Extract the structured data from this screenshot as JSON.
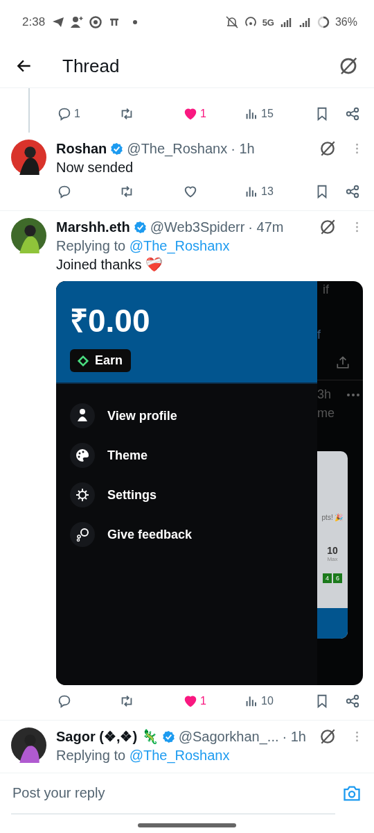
{
  "status_bar": {
    "time": "2:38",
    "network": "5G",
    "battery": "36%"
  },
  "header": {
    "title": "Thread"
  },
  "tweets": [
    {
      "kind": "actions_only",
      "actions": {
        "replies": "1",
        "liked": true,
        "likes": "1",
        "views": "15"
      }
    },
    {
      "kind": "post",
      "name": "Roshan",
      "verified": true,
      "handle": "@The_Roshanx",
      "separator": "·",
      "time": "1h",
      "text": "Now sended",
      "actions": {
        "liked": false,
        "views": "13"
      }
    },
    {
      "kind": "post",
      "name": "Marshh.eth",
      "verified": true,
      "handle": "@Web3Spiderr",
      "separator": "·",
      "time": "47m",
      "replying_label": "Replying to",
      "replying_to": "@The_Roshanx",
      "text": "Joined thanks ❤️‍🩹",
      "embed": {
        "balance": "₹0.00",
        "earn_label": "Earn",
        "menu": [
          {
            "kind": "profile",
            "label": "View profile"
          },
          {
            "kind": "theme",
            "label": "Theme"
          },
          {
            "kind": "settings",
            "label": "Settings"
          },
          {
            "kind": "feedback",
            "label": "Give feedback"
          }
        ],
        "behind": [
          "if",
          "f",
          "3h",
          "me",
          "pts! 🎉",
          "10",
          "Max",
          "4",
          "6"
        ]
      },
      "actions": {
        "liked": true,
        "likes": "1",
        "views": "10"
      }
    },
    {
      "kind": "cut",
      "name": "Sagor (❖,❖) 🦎",
      "verified": true,
      "handle": "@Sagorkhan_...",
      "separator": "·",
      "time": "1h",
      "replying_label": "Replying to",
      "replying_to": "@The_Roshanx"
    }
  ],
  "reply_bar": {
    "placeholder": "Post your reply"
  }
}
